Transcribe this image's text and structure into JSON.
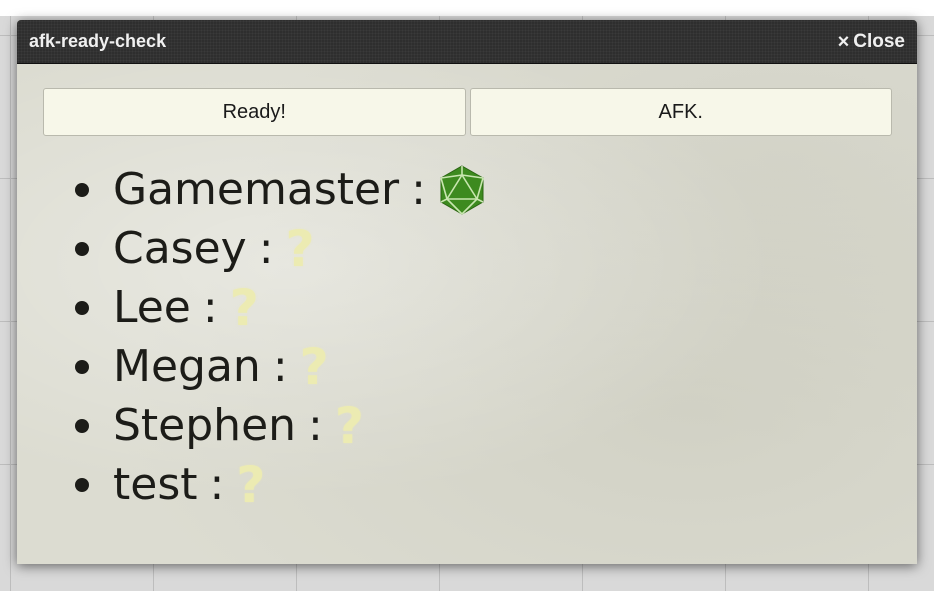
{
  "dialog": {
    "title": "afk-ready-check",
    "close_label": "Close",
    "close_icon": "×"
  },
  "buttons": {
    "ready_label": "Ready!",
    "afk_label": "AFK."
  },
  "players": [
    {
      "name": "Gamemaster",
      "sep": ":",
      "status": "ready"
    },
    {
      "name": "Casey",
      "sep": ":",
      "status": "unknown",
      "status_glyph": "?"
    },
    {
      "name": "Lee",
      "sep": ":",
      "status": "unknown",
      "status_glyph": "?"
    },
    {
      "name": "Megan",
      "sep": ":",
      "status": "unknown",
      "status_glyph": "?"
    },
    {
      "name": "Stephen",
      "sep": ":",
      "status": "unknown",
      "status_glyph": "?"
    },
    {
      "name": "test",
      "sep": ":",
      "status": "unknown",
      "status_glyph": "?"
    }
  ],
  "colors": {
    "ready_icon": "#3d8a1f",
    "unknown_icon": "#ecebb2"
  },
  "icons": {
    "ready": "d20-icon",
    "unknown": "question-mark-icon"
  }
}
